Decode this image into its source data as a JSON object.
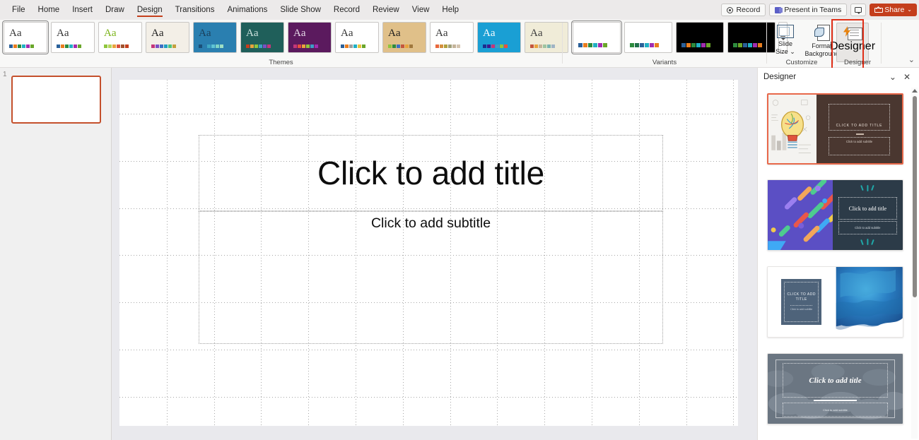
{
  "app": {
    "name": "PowerPoint",
    "active_tab": "Design"
  },
  "menu": {
    "items": [
      {
        "label": "File",
        "active": false
      },
      {
        "label": "Home",
        "active": false
      },
      {
        "label": "Insert",
        "active": false
      },
      {
        "label": "Draw",
        "active": false
      },
      {
        "label": "Design",
        "active": true
      },
      {
        "label": "Transitions",
        "active": false
      },
      {
        "label": "Animations",
        "active": false
      },
      {
        "label": "Slide Show",
        "active": false
      },
      {
        "label": "Record",
        "active": false
      },
      {
        "label": "Review",
        "active": false
      },
      {
        "label": "View",
        "active": false
      },
      {
        "label": "Help",
        "active": false
      }
    ]
  },
  "titlebar": {
    "record_label": "Record",
    "present_in_teams_label": "Present in Teams",
    "comments_label": "",
    "share_label": "Share",
    "share_caret": "⌄",
    "share_color": "#c43e1c"
  },
  "ribbon": {
    "collapse_glyph": "⌄",
    "groups": [
      {
        "name": "Themes",
        "label": "Themes"
      },
      {
        "name": "Variants",
        "label": "Variants"
      },
      {
        "name": "Customize",
        "label": "Customize"
      },
      {
        "name": "Designer",
        "label": "Designer"
      }
    ],
    "themes": {
      "label": "Themes",
      "more_label": "More",
      "items": [
        {
          "name": "office-theme",
          "aa": "Aa",
          "selected": true,
          "swatches": [
            "#2a6099",
            "#e87d1e",
            "#2e8b3d",
            "#21b0c4",
            "#a12db0",
            "#6aa62a"
          ],
          "bg": "#ffffff",
          "aa_color": "#333333"
        },
        {
          "name": "facet-theme",
          "aa": "Aa",
          "selected": false,
          "swatches": [
            "#2a6099",
            "#e87d1e",
            "#2e8b3d",
            "#21b0c4",
            "#a12db0",
            "#6aa62a"
          ],
          "bg": "#ffffff",
          "aa_color": "#333333"
        },
        {
          "name": "green-swoosh-theme",
          "aa": "Aa",
          "selected": false,
          "swatches": [
            "#8fc63d",
            "#b5d45a",
            "#e8a33d",
            "#d94f3d",
            "#a0522d",
            "#c43e1c"
          ],
          "bg": "#ffffff",
          "aa_color": "#7ab317"
        },
        {
          "name": "wood-type-theme",
          "aa": "Aa",
          "selected": false,
          "swatches": [
            "#c4367a",
            "#7a4fc4",
            "#3d6fc4",
            "#21a0c4",
            "#4fc47a",
            "#c4a03d"
          ],
          "bg": "#f3efe7",
          "aa_color": "#1a1a1a"
        },
        {
          "name": "blue-dots-theme",
          "aa": "Aa",
          "selected": false,
          "swatches": [
            "#1a4f78",
            "#2a7fb0",
            "#3fa8c4",
            "#5fc4d4",
            "#7fd4c4",
            "#9fe0c4"
          ],
          "bg": "#2a7fb0",
          "aa_color": "#1a3f5a"
        },
        {
          "name": "teal-gradient-theme",
          "aa": "Aa",
          "selected": false,
          "swatches": [
            "#c43e1c",
            "#e8a33d",
            "#8fc63d",
            "#3d9fc4",
            "#7a4fc4",
            "#c4367a"
          ],
          "bg": "#1f5f5a",
          "aa_color": "#cfe4e0"
        },
        {
          "name": "purple-theme",
          "aa": "Aa",
          "selected": false,
          "swatches": [
            "#c4367a",
            "#e8503d",
            "#e8a33d",
            "#8fc63d",
            "#3d9fc4",
            "#a12db0"
          ],
          "bg": "#5b1a5e",
          "aa_color": "#e8dcea"
        },
        {
          "name": "basis-theme",
          "aa": "Aa",
          "selected": false,
          "swatches": [
            "#2a6099",
            "#e87d1e",
            "#a0a0a0",
            "#21b0c4",
            "#e8c43d",
            "#6aa62a"
          ],
          "bg": "#ffffff",
          "aa_color": "#333333"
        },
        {
          "name": "wood-frame-theme",
          "aa": "Aa",
          "selected": false,
          "swatches": [
            "#8fc63d",
            "#2e8b3d",
            "#3d6fc4",
            "#c4563d",
            "#e8a33d",
            "#a0783d"
          ],
          "bg": "#e0c089",
          "aa_color": "#1a1a1a"
        },
        {
          "name": "berlin-theme",
          "aa": "Aa",
          "selected": false,
          "swatches": [
            "#e8683d",
            "#d4903d",
            "#b0a03d",
            "#9f9f7a",
            "#c4b49a",
            "#d4c4b0"
          ],
          "bg": "#ffffff",
          "aa_color": "#333333"
        },
        {
          "name": "blue-ion-theme",
          "aa": "Aa",
          "selected": false,
          "swatches": [
            "#1a2f8e",
            "#3d1a8e",
            "#c4367a",
            "#3d9fc4",
            "#8fc63d",
            "#e8503d"
          ],
          "bg": "#1a9fd4",
          "aa_color": "#ffffff"
        },
        {
          "name": "cream-theme",
          "aa": "Aa",
          "selected": false,
          "swatches": [
            "#c4563d",
            "#e8a33d",
            "#c4b49a",
            "#9fc4a0",
            "#7ab4b0",
            "#a0b4c4"
          ],
          "bg": "#f0ecd8",
          "aa_color": "#3a3a3a"
        }
      ]
    },
    "variants": {
      "label": "Variants",
      "more_label": "More",
      "items": [
        {
          "name": "variant-light-1",
          "selected": true,
          "bg": "#ffffff",
          "swatches": [
            "#2a6099",
            "#e87d1e",
            "#2e8b3d",
            "#21b0c4",
            "#a12db0",
            "#6aa62a"
          ]
        },
        {
          "name": "variant-light-2",
          "selected": false,
          "bg": "#ffffff",
          "swatches": [
            "#2e8b3d",
            "#1f6f4a",
            "#2a6099",
            "#21b0c4",
            "#a12db0",
            "#e87d1e"
          ]
        },
        {
          "name": "variant-dark-1",
          "selected": false,
          "bg": "#000000",
          "swatches": [
            "#2a6099",
            "#e87d1e",
            "#2e8b3d",
            "#21b0c4",
            "#a12db0",
            "#6aa62a"
          ]
        },
        {
          "name": "variant-dark-2",
          "selected": false,
          "bg": "#000000",
          "swatches": [
            "#2e8b3d",
            "#6aa62a",
            "#2a6099",
            "#21b0c4",
            "#a12db0",
            "#e87d1e"
          ]
        }
      ]
    },
    "customize": {
      "label": "Customize",
      "slide_size_label_line1": "Slide",
      "slide_size_label_line2": "Size",
      "slide_size_caret": "⌄",
      "format_background_line1": "Format",
      "format_background_line2": "Background"
    },
    "designer": {
      "group_label": "Designer",
      "button_label": "Designer",
      "highlighted": true,
      "highlight_color": "#e02f18"
    }
  },
  "slides_panel": {
    "slides": [
      {
        "number": "1",
        "selected": true
      }
    ]
  },
  "canvas": {
    "title_placeholder": "Click to add title",
    "subtitle_placeholder": "Click to add subtitle",
    "grid_visible": true
  },
  "designer_pane": {
    "title": "Designer",
    "collapse_glyph": "⌄",
    "close_glyph": "✕",
    "ideas": [
      {
        "name": "design-idea-lightbulb",
        "selected": true,
        "title_text": "CLICK TO ADD TITLE",
        "subtitle_text": "Click to add subtitle",
        "panel_color": "#4a3730",
        "image_desc": "lightbulb-sketch"
      },
      {
        "name": "design-idea-confetti",
        "selected": false,
        "title_text": "Click to add title",
        "subtitle_text": "Click to add subtitle",
        "panel_color": "#2c3b48",
        "image_desc": "colorful-rounded-shapes",
        "accent_color": "#20a8a8"
      },
      {
        "name": "design-idea-watercolor",
        "selected": false,
        "title_text": "CLICK TO ADD TITLE",
        "subtitle_text": "Click to add subtitle",
        "panel_color": "#4e637a",
        "image_desc": "blue-watercolor"
      },
      {
        "name": "design-idea-clouds",
        "selected": false,
        "title_text": "Click to add title",
        "subtitle_text": "Click to add subtitle",
        "panel_color": "#6b7682",
        "image_desc": "gray-blue-clouds"
      }
    ]
  }
}
